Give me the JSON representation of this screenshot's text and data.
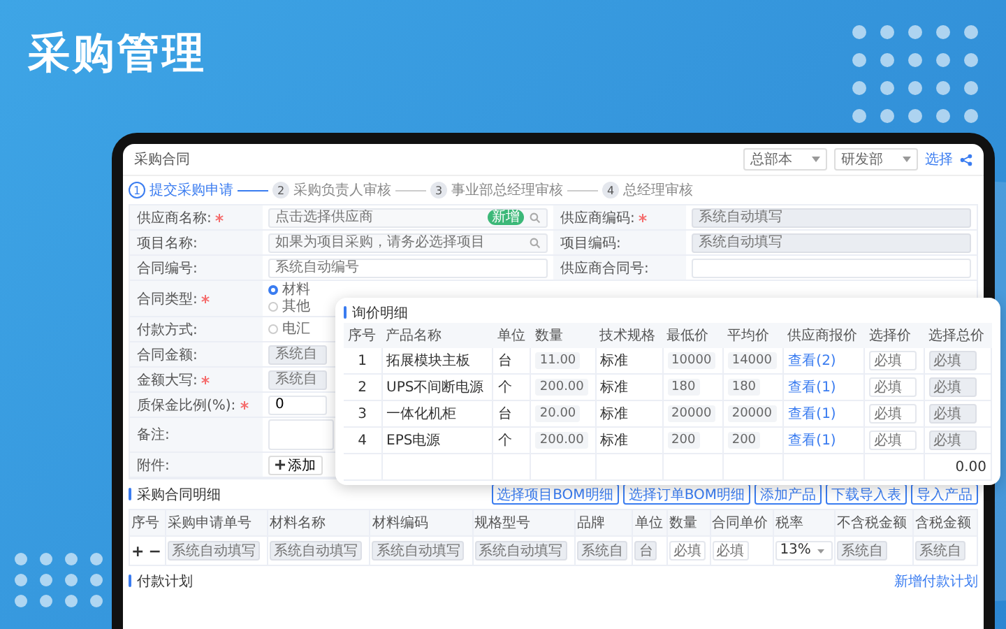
{
  "page_title": "采购管理",
  "window": {
    "title": "采购合同",
    "selects": [
      "总部本",
      "研发部"
    ],
    "link": "选择"
  },
  "steps": [
    {
      "number": "1",
      "label": "提交采购申请",
      "selected": true
    },
    {
      "number": "2",
      "label": "采购负责人审核",
      "selected": false
    },
    {
      "number": "3",
      "label": "事业部总经理审核",
      "selected": false
    },
    {
      "number": "4",
      "label": "总经理审核",
      "selected": false
    }
  ],
  "form_top": [
    {
      "left": {
        "label": "供应商名称:",
        "required": true,
        "placeholder": "点击选择供应商",
        "badge": "新增",
        "search": true
      },
      "right": {
        "label": "供应商编码:",
        "required": true,
        "placeholder": "系统自动填写",
        "disabled": true
      }
    },
    {
      "left": {
        "label": "项目名称:",
        "required": false,
        "placeholder": "如果为项目采购，请务必选择项目",
        "search": true
      },
      "right": {
        "label": "项目编码:",
        "required": false,
        "placeholder": "系统自动填写",
        "disabled": true
      }
    },
    {
      "left": {
        "label": "合同编号:",
        "required": false,
        "placeholder": "系统自动编号",
        "search": false
      },
      "right": {
        "label": "供应商合同号:",
        "required": false,
        "disabled": false
      }
    }
  ],
  "form_left": [
    {
      "kind": "radio",
      "label": "合同类型:",
      "required": true,
      "options": [
        {
          "label": "材料",
          "checked": true
        },
        {
          "label": "其他",
          "checked": false
        }
      ]
    },
    {
      "kind": "radio",
      "label": "付款方式:",
      "required": false,
      "options": [
        {
          "label": "电汇",
          "checked": false
        }
      ]
    },
    {
      "kind": "input",
      "label": "合同金额:",
      "required": false,
      "placeholder": "系统自"
    },
    {
      "kind": "input",
      "label": "金额大写:",
      "required": true,
      "placeholder": "系统自"
    },
    {
      "kind": "value",
      "label": "质保金比例(%):",
      "required": true,
      "value": "0"
    },
    {
      "kind": "textarea",
      "label": "备注:",
      "required": false
    },
    {
      "kind": "upload",
      "label": "附件:",
      "required": false,
      "button": "添加"
    }
  ],
  "inquiry": {
    "title": "询价明细",
    "columns": [
      "序号",
      "产品名称",
      "单位",
      "数量",
      "技术规格",
      "最低价",
      "平均价",
      "供应商报价",
      "选择价",
      "选择总价"
    ],
    "rows": [
      {
        "no": "1",
        "name": "拓展模块主板",
        "unit": "台",
        "qty": "11.00",
        "spec": "标准",
        "min": "10000",
        "avg": "14000",
        "quotes": "查看(2)",
        "price": {
          "placeholder": "必填"
        },
        "total": {
          "placeholder": "必填"
        }
      },
      {
        "no": "2",
        "name": "UPS不间断电源",
        "unit": "个",
        "qty": "200.00",
        "spec": "标准",
        "min": "180",
        "avg": "180",
        "quotes": "查看(1)",
        "price": {
          "placeholder": "必填"
        },
        "total": {
          "placeholder": "必填"
        }
      },
      {
        "no": "3",
        "name": "一体化机柜",
        "unit": "台",
        "qty": "20.00",
        "spec": "标准",
        "min": "20000",
        "avg": "20000",
        "quotes": "查看(1)",
        "price": {
          "placeholder": "必填"
        },
        "total": {
          "placeholder": "必填"
        }
      },
      {
        "no": "4",
        "name": "EPS电源",
        "unit": "个",
        "qty": "200.00",
        "spec": "标准",
        "min": "200",
        "avg": "200",
        "quotes": "查看(1)",
        "price": {
          "placeholder": "必填"
        },
        "total": {
          "placeholder": "必填"
        }
      }
    ],
    "total": "0.00"
  },
  "details": {
    "title": "采购合同明细",
    "buttons": [
      "选择项目BOM明细",
      "选择订单BOM明细",
      "添加产品",
      "下载导入表",
      "导入产品"
    ],
    "columns": [
      "序号",
      "采购申请单号",
      "材料名称",
      "材料编码",
      "规格型号",
      "品牌",
      "单位",
      "数量",
      "合同单价",
      "税率",
      "不含税金额",
      "含税金额"
    ],
    "row": {
      "controls": [
        "+",
        "−"
      ],
      "cells": [
        {
          "kind": "disabled",
          "placeholder": "系统自动填写"
        },
        {
          "kind": "disabled",
          "placeholder": "系统自动填写"
        },
        {
          "kind": "disabled",
          "placeholder": "系统自动填写"
        },
        {
          "kind": "disabled",
          "placeholder": "系统自动填写"
        },
        {
          "kind": "disabled",
          "placeholder": "系统自"
        },
        {
          "kind": "disabled",
          "placeholder": "台"
        },
        {
          "kind": "input",
          "placeholder": "必填"
        },
        {
          "kind": "input",
          "placeholder": "必填"
        },
        {
          "kind": "select",
          "value": "13%"
        },
        {
          "kind": "disabled",
          "placeholder": "系统自"
        },
        {
          "kind": "disabled",
          "placeholder": "系统自"
        }
      ]
    }
  },
  "payment": {
    "title": "付款计划",
    "link": "新增付款计划"
  }
}
